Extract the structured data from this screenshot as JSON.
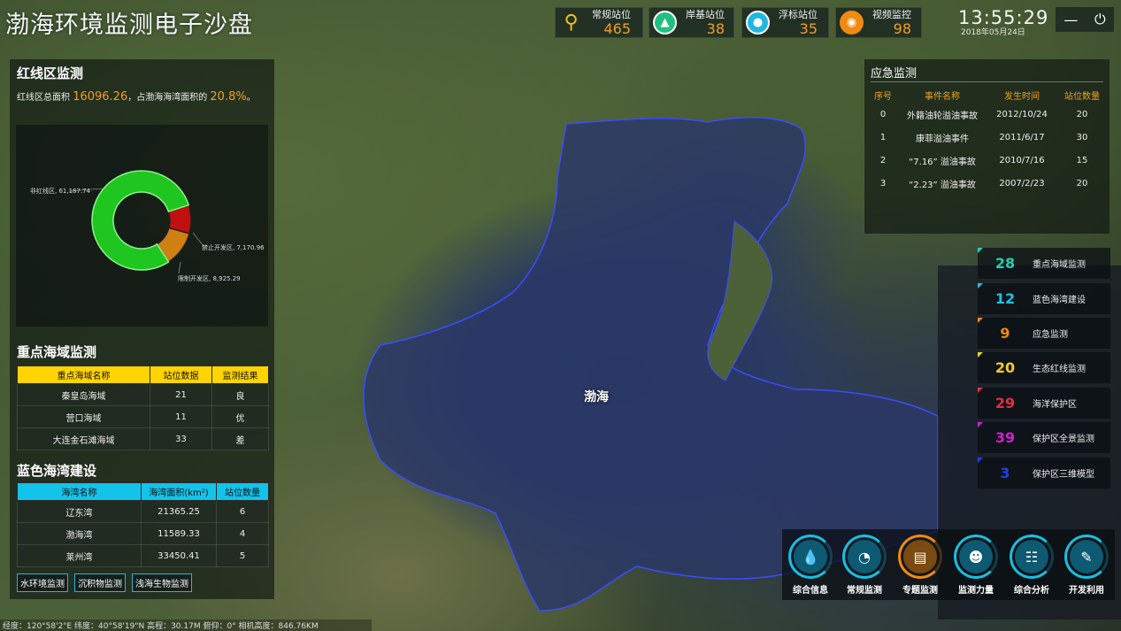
{
  "app_title": "渤海环境监测电子沙盘",
  "top_stats": [
    {
      "label": "常规站位",
      "value": "465",
      "icon": "map-pin-icon",
      "color": "#f0c020"
    },
    {
      "label": "岸基站位",
      "value": "38",
      "icon": "shore-station-icon",
      "color": "#20c080"
    },
    {
      "label": "浮标站位",
      "value": "35",
      "icon": "buoy-icon",
      "color": "#20b8e0"
    },
    {
      "label": "视频监控",
      "value": "98",
      "icon": "camera-icon",
      "color": "#f08a10"
    }
  ],
  "clock": {
    "time": "13:55:29",
    "date": "2018年05月24日"
  },
  "redline": {
    "title": "红线区监测",
    "summary_prefix": "红线区总面积",
    "total_area": "16096.26",
    "summary_mid": "，占渤海海湾面积的",
    "percent": "20.8%",
    "summary_suffix": "。"
  },
  "chart_data": {
    "type": "pie",
    "categories": [
      "非红线区",
      "禁止开发区",
      "限制开发区"
    ],
    "values": [
      61187.74,
      7170.96,
      8925.29
    ],
    "labels": [
      "非红线区, 61,187.74",
      "禁止开发区, 7,170.96",
      "限制开发区, 8,925.29"
    ],
    "colors": [
      "#1fc61f",
      "#c01010",
      "#d08010"
    ]
  },
  "seas": {
    "title": "重点海域监测",
    "headers": [
      "重点海域名称",
      "站位数据",
      "监测结果"
    ],
    "rows": [
      {
        "name": "秦皇岛海域",
        "count": "21",
        "result": "良"
      },
      {
        "name": "营口海域",
        "count": "11",
        "result": "优"
      },
      {
        "name": "大连金石滩海域",
        "count": "33",
        "result": "差"
      }
    ]
  },
  "bays": {
    "title": "蓝色海湾建设",
    "headers": [
      "海湾名称",
      "海湾面积(km²)",
      "站位数量"
    ],
    "rows": [
      {
        "name": "辽东湾",
        "area": "21365.25",
        "count": "6"
      },
      {
        "name": "渤海湾",
        "area": "11589.33",
        "count": "4"
      },
      {
        "name": "莱州湾",
        "area": "33450.41",
        "count": "5"
      }
    ]
  },
  "bottom_tabs": [
    "水环境监测",
    "沉积物监测",
    "浅海生物监测"
  ],
  "emergency": {
    "title": "应急监测",
    "headers": [
      "序号",
      "事件名称",
      "发生时间",
      "站位数量"
    ],
    "rows": [
      [
        "0",
        "外籍油轮溢油事故",
        "2012/10/24",
        "20"
      ],
      [
        "1",
        "康菲溢油事件",
        "2011/6/17",
        "30"
      ],
      [
        "2",
        "“7.16” 溢油事故",
        "2010/7/16",
        "15"
      ],
      [
        "3",
        "“2.23” 溢油事故",
        "2007/2/23",
        "20"
      ]
    ]
  },
  "right_list": [
    {
      "num": "28",
      "label": "重点海域监测",
      "color": "#20d0b0"
    },
    {
      "num": "12",
      "label": "蓝色海湾建设",
      "color": "#20c0e8"
    },
    {
      "num": "9",
      "label": "应急监测",
      "color": "#f08a10"
    },
    {
      "num": "20",
      "label": "生态红线监测",
      "color": "#f0d020"
    },
    {
      "num": "29",
      "label": "海洋保护区",
      "color": "#e03040"
    },
    {
      "num": "39",
      "label": "保护区全景监测",
      "color": "#d020d0"
    },
    {
      "num": "3",
      "label": "保护区三维模型",
      "color": "#2040e0"
    }
  ],
  "toolbar": [
    {
      "label": "综合信息",
      "icon": "water-drops-icon"
    },
    {
      "label": "常规监测",
      "icon": "gauge-icon"
    },
    {
      "label": "专题监测",
      "icon": "report-icon"
    },
    {
      "label": "监测力量",
      "icon": "personnel-icon"
    },
    {
      "label": "综合分析",
      "icon": "clipboard-icon"
    },
    {
      "label": "开发利用",
      "icon": "book-icon"
    }
  ],
  "map": {
    "sea_label": "渤海"
  },
  "coords": "经度：120°58'2\"E   纬度：40°58'19\"N  高程：30.17M    俯仰：0°      相机高度：846.76KM"
}
